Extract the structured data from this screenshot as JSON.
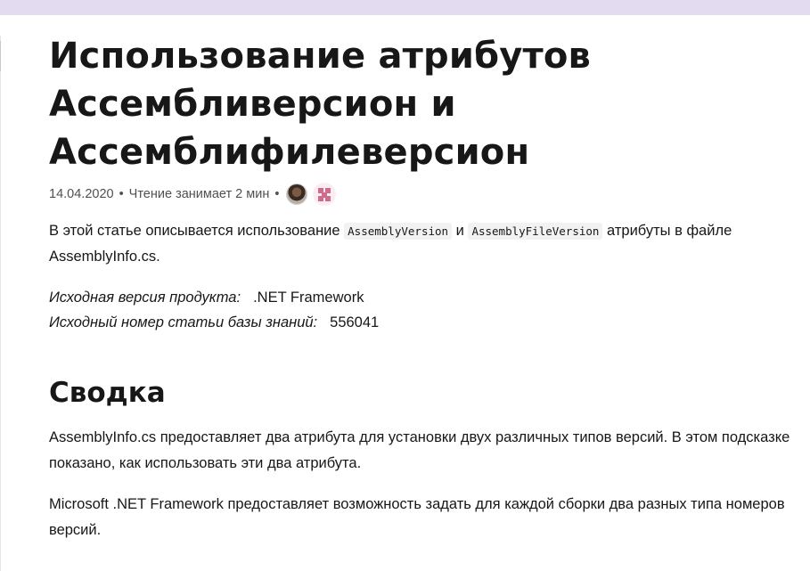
{
  "article": {
    "title_lines": [
      "Использование атрибутов",
      "Ассембливерсион и",
      "Ассемблифилеверсион"
    ],
    "meta": {
      "date": "14.04.2020",
      "separator": "•",
      "read_time": "Чтение занимает 2 мин"
    },
    "intro": {
      "before": "В этой статье описывается использование ",
      "code1": "AssemblyVersion",
      "middle": " и ",
      "code2": "AssemblyFileVersion",
      "after": " атрибуты в файле AssemblyInfo.cs."
    },
    "applies": {
      "product_label": "Исходная версия продукта:",
      "product_value": ".NET Framework",
      "kb_label": "Исходный номер статьи базы знаний:",
      "kb_value": "556041"
    },
    "summary": {
      "heading": "Сводка",
      "p1": "AssemblyInfo.cs предоставляет два атрибута для установки двух различных типов версий. В этом подсказке показано, как использовать эти два атрибута.",
      "p2": "Microsoft .NET Framework предоставляет возможность задать для каждой сборки два разных типа номеров версий."
    }
  },
  "colors": {
    "top_bar": "#e3dcf0",
    "text": "#171717",
    "meta_text": "#505050",
    "code_bg": "#f2f2f2"
  }
}
